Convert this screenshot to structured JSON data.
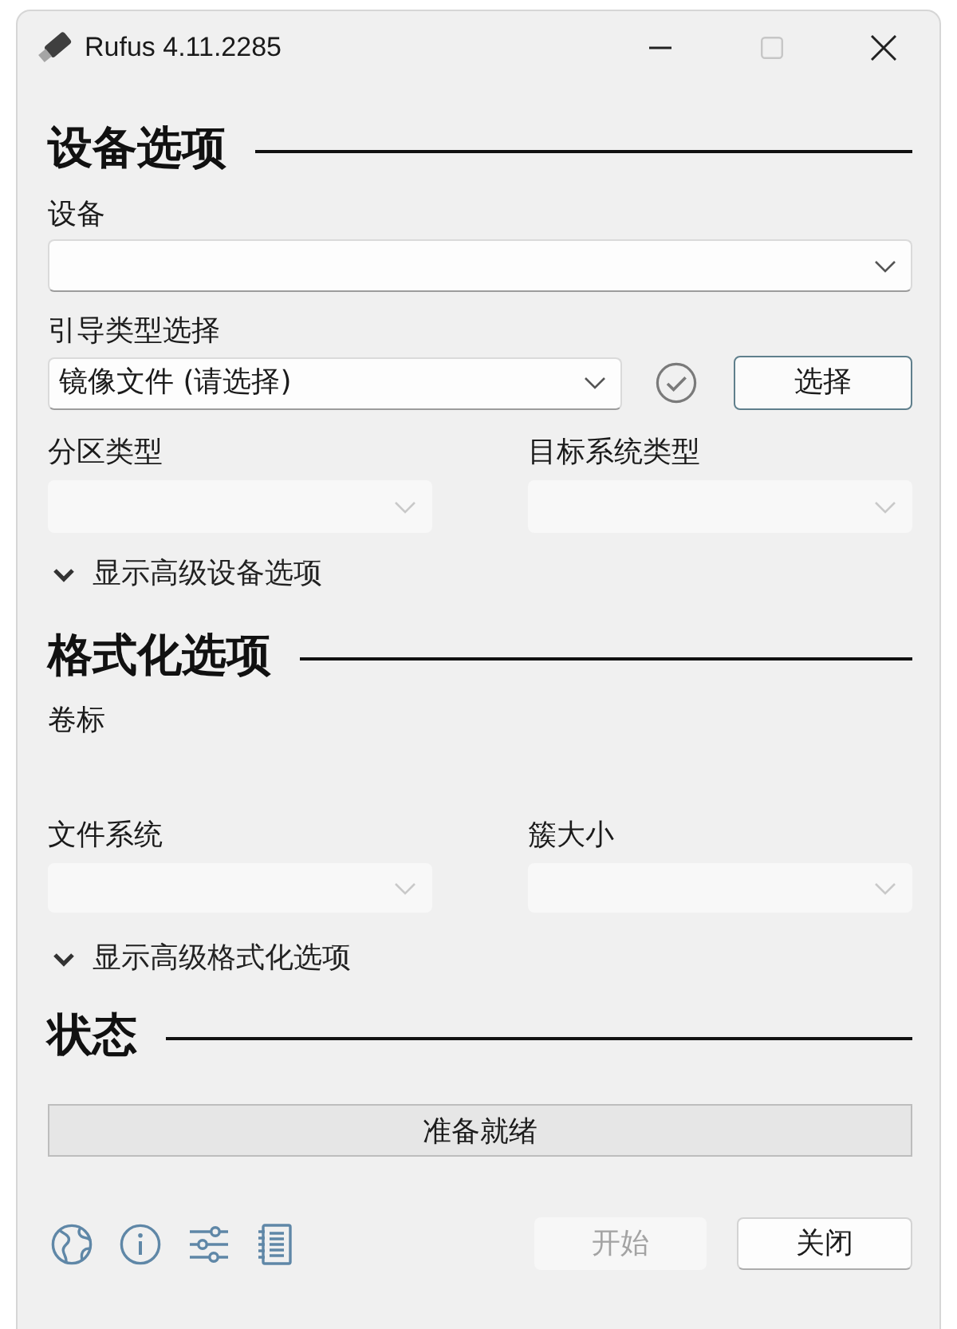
{
  "window": {
    "title": "Rufus 4.11.2285",
    "controls": [
      {
        "kind": "minimize",
        "disabled": false
      },
      {
        "kind": "maximize",
        "disabled": true
      },
      {
        "kind": "close",
        "disabled": false
      }
    ]
  },
  "device_options": {
    "heading": "设备选项",
    "device": {
      "label": "设备",
      "disabled": false
    },
    "boot_selection": {
      "label": "引导类型选择",
      "value": "镜像文件 (请选择)",
      "disabled": false,
      "select_button": "选择"
    },
    "partition_scheme": {
      "label": "分区类型",
      "disabled": true
    },
    "target_system": {
      "label": "目标系统类型",
      "disabled": true
    },
    "advanced_toggle": {
      "label": "显示高级设备选项",
      "expanded": false
    }
  },
  "format_options": {
    "heading": "格式化选项",
    "volume_label": {
      "label": "卷标"
    },
    "file_system": {
      "label": "文件系统",
      "disabled": true
    },
    "cluster_size": {
      "label": "簇大小",
      "disabled": true
    },
    "advanced_toggle": {
      "label": "显示高级格式化选项",
      "expanded": false
    }
  },
  "status": {
    "heading": "状态",
    "text": "准备就绪"
  },
  "footer": {
    "tools": [
      {
        "kind": "globe"
      },
      {
        "kind": "info"
      },
      {
        "kind": "settings"
      },
      {
        "kind": "log"
      }
    ],
    "buttons": [
      {
        "label": "开始",
        "disabled": true
      },
      {
        "label": "关闭",
        "disabled": false
      }
    ]
  }
}
